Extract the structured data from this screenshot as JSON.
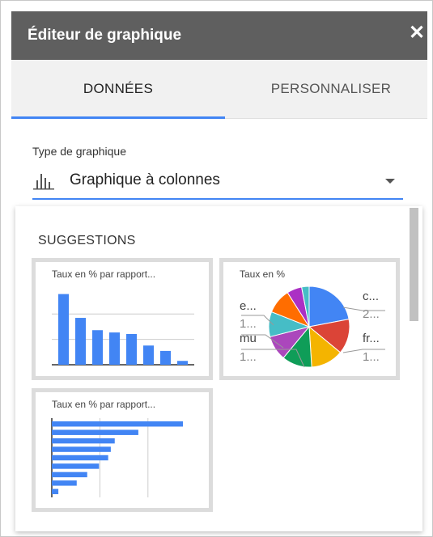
{
  "header": {
    "title": "Éditeur de graphique",
    "close_icon": "close-icon"
  },
  "tabs": [
    {
      "label": "DONNÉES",
      "active": true
    },
    {
      "label": "PERSONNALISER",
      "active": false
    }
  ],
  "chart_type": {
    "label": "Type de graphique",
    "value": "Graphique à colonnes",
    "icon": "column-chart-icon"
  },
  "suggestions": {
    "title": "SUGGESTIONS",
    "cards": [
      {
        "title": "Taux en % par rapport...",
        "type": "column"
      },
      {
        "title": "Taux en %",
        "type": "pie",
        "labels": [
          {
            "name": "c...",
            "value": "2..."
          },
          {
            "name": "e...",
            "value": "1..."
          },
          {
            "name": "fr...",
            "value": "1..."
          },
          {
            "name": "mu",
            "value": "1..."
          }
        ]
      },
      {
        "title": "Taux en % par rapport...",
        "type": "bar"
      }
    ]
  },
  "colors": {
    "header_bg": "#5f5f5f",
    "accent": "#4285f4",
    "tab_bg": "#f1f1f1"
  },
  "chart_data": [
    {
      "type": "bar",
      "title": "Taux en % par rapport...",
      "orientation": "vertical",
      "values": [
        92,
        61,
        45,
        42,
        40,
        25,
        18,
        5
      ],
      "ylim": [
        0,
        100
      ],
      "grid": true,
      "color": "#4285f4"
    },
    {
      "type": "pie",
      "title": "Taux en %",
      "slices": [
        {
          "value": 22,
          "color": "#4285f4"
        },
        {
          "value": 14,
          "color": "#db4437"
        },
        {
          "value": 13,
          "color": "#f4b400"
        },
        {
          "value": 12,
          "color": "#0f9d58"
        },
        {
          "value": 10,
          "color": "#ab47bc"
        },
        {
          "value": 10,
          "color": "#46bdc6"
        },
        {
          "value": 10,
          "color": "#ff6d00"
        },
        {
          "value": 6,
          "color": "#ab30c4"
        },
        {
          "value": 3,
          "color": "#46bdc6"
        }
      ]
    },
    {
      "type": "bar",
      "title": "Taux en % par rapport...",
      "orientation": "horizontal",
      "values": [
        100,
        66,
        48,
        45,
        43,
        36,
        27,
        19,
        5
      ],
      "xlim": [
        0,
        100
      ],
      "grid": true,
      "color": "#4285f4"
    }
  ]
}
